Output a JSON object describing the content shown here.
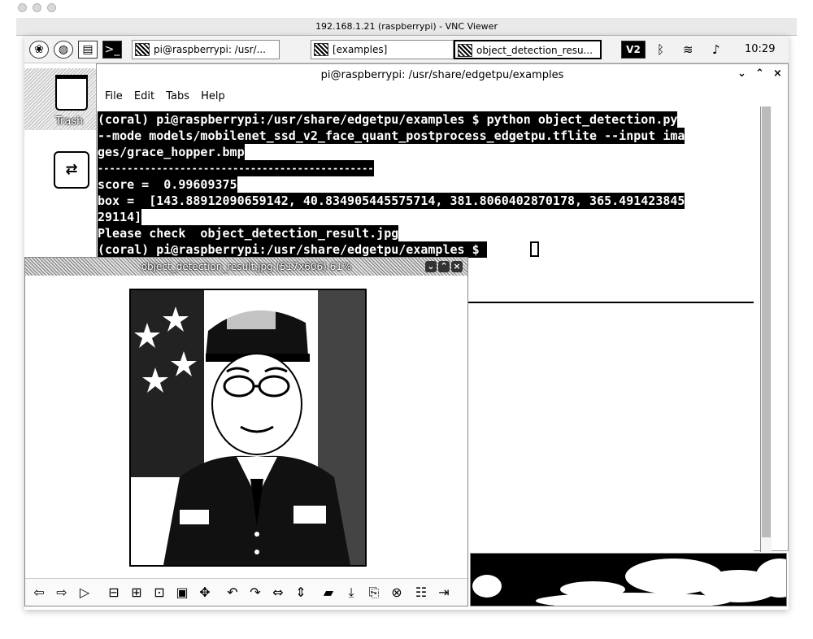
{
  "vnc": {
    "title": "192.168.1.21 (raspberrypi) - VNC Viewer"
  },
  "panel": {
    "tasks": [
      {
        "label": "pi@raspberrypi: /usr/..."
      },
      {
        "label": "[examples]"
      },
      {
        "label": "object_detection_resu..."
      }
    ],
    "clock": "10:29"
  },
  "desktop": {
    "trash_label": "Trash"
  },
  "terminal": {
    "title": "pi@raspberrypi: /usr/share/edgetpu/examples",
    "menu": [
      "File",
      "Edit",
      "Tabs",
      "Help"
    ],
    "lines": [
      "(coral) pi@raspberrypi:/usr/share/edgetpu/examples $ python object_detection.py",
      "--mode models/mobilenet_ssd_v2_face_quant_postprocess_edgetpu.tflite --input ima",
      "ges/grace_hopper.bmp",
      "-----------------------------------------------",
      "score =  0.99609375",
      "box =  [143.88912090659142, 40.834905445575714, 381.8060402870178, 365.491423845",
      "29114]",
      "Please check  object_detection_result.jpg",
      "(coral) pi@raspberrypi:/usr/share/edgetpu/examples $ "
    ]
  },
  "viewer": {
    "title": "object_detection_result.jpg (517x606) 61%",
    "toolbar_icons": [
      "prev-icon",
      "next-icon",
      "play-icon",
      "zoom-out-icon",
      "zoom-in-icon",
      "zoom-fit-icon",
      "zoom-original-icon",
      "fullscreen-icon",
      "rotate-left-icon",
      "rotate-right-icon",
      "flip-horizontal-icon",
      "flip-vertical-icon",
      "open-folder-icon",
      "save-icon",
      "save-as-icon",
      "delete-icon",
      "preferences-icon",
      "quit-icon"
    ]
  }
}
